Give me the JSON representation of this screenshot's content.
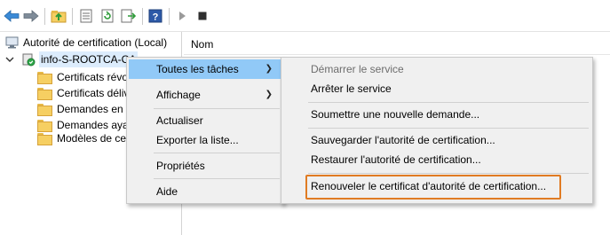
{
  "toolbar": {
    "icons": [
      "back-arrow-icon",
      "forward-arrow-icon",
      "up-folder-icon",
      "properties-icon",
      "refresh-icon",
      "export-icon",
      "help-icon",
      "play-icon",
      "stop-icon"
    ]
  },
  "tree": {
    "root": "Autorité de certification (Local)",
    "ca": "info-S-ROOTCA-CA",
    "children": [
      "Certificats révo",
      "Certificats déliv",
      "Demandes en a",
      "Demandes aya",
      "Modèles de ce"
    ]
  },
  "list": {
    "column_name": "Nom"
  },
  "context_menu": {
    "all_tasks": "Toutes les tâches",
    "view": "Affichage",
    "refresh": "Actualiser",
    "export": "Exporter la liste...",
    "properties": "Propriétés",
    "help": "Aide"
  },
  "submenu": {
    "start_service": "Démarrer le service",
    "stop_service": "Arrêter le service",
    "submit_request": "Soumettre une nouvelle demande...",
    "backup_ca": "Sauvegarder l'autorité de certification...",
    "restore_ca": "Restaurer l'autorité de certification...",
    "renew_cert": "Renouveler le certificat d'autorité de certification..."
  },
  "colors": {
    "highlight": "#91c9f7",
    "callout": "#e07b23",
    "menu_bg": "#f0f0f0",
    "folder": "#f6cf62"
  }
}
